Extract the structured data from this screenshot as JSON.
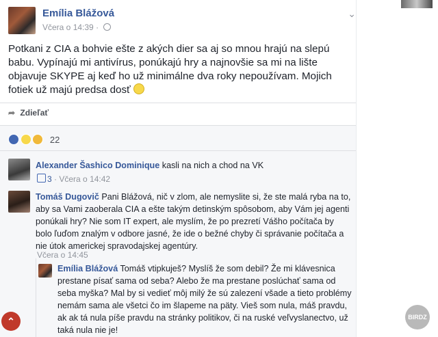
{
  "post": {
    "author": "Emília Blážová",
    "timestamp": "Včera o 14:39",
    "separator": "·",
    "text": "Potkani z CIA a bohvie ešte z akých dier sa aj so mnou hrajú na slepú babu. Vypínajú mi antivírus, ponúkajú hry a najnovšie sa mi na lište objavuje SKYPE aj keď ho už minimálne dva roky nepoužívam. Mojich fotiek už majú predsa dosť",
    "share_label": "Zdieľať",
    "reactions_count": "22"
  },
  "comments": [
    {
      "author": "Alexander Šashico Dominique",
      "text": "kasli na nich a chod na VK",
      "likes": "3",
      "time": "Včera o 14:42"
    },
    {
      "author": "Tomáš Dugovič",
      "text": "Pani Blážová, nič v zlom, ale nemyslite si, že ste malá ryba na to, aby sa Vami zaoberala CIA a ešte takým detinským spôsobom, aby Vám jej agenti ponúkali hry? Nie som IT expert, ale myslím, že po prezretí Vášho počítača by bolo ľuďom znalým v odbore jasné, že ide o bežné chyby či správanie počítača a nie útok americkej spravodajskej agentúry.",
      "time": "Včera o 14:45"
    },
    {
      "author": "Emília Blážová",
      "text": "Tomáš vtipkuješ? Myslíš že som debil? Že mi klávesnica prestane písať sama od seba? Alebo že ma prestane poslúchať sama od seba myška? Mal by si vedieť môj milý že sú zalezení všade a tieto problémy nemám sama ale všetci čo im šlapeme na päty. Vieš som nula, máš pravdu, ak ak tá nula píše pravdu na stránky politikov, či na ruské veľvyslanectvo, už taká nula nie je!"
    }
  ],
  "watermark": "BIRDZ",
  "scroll_up_icon": "chevron-up-icon"
}
